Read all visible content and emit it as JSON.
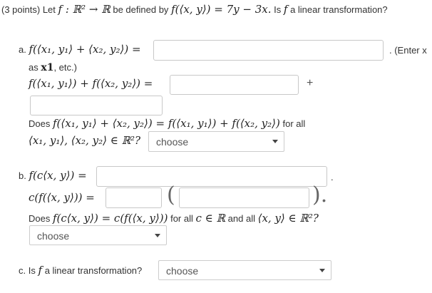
{
  "header": {
    "points": "(3 points)",
    "intro_text": "Let",
    "map": "f : ℝ² → ℝ",
    "defined_text": "be defined by",
    "formula": "f(⟨x, y⟩) = 7y − 3x.",
    "question_pre": "Is",
    "f_symbol": "f",
    "question_post": "a linear transformation?"
  },
  "part_a": {
    "label": "a.",
    "expr1": "f(⟨x₁, y₁⟩ + ⟨x₂, y₂⟩) =",
    "input1_value": "",
    "enter_note": ". (Enter x",
    "hint_pre": "as",
    "hint_code": "x1",
    "hint_post": ", etc.)",
    "expr2": "f(⟨x₁, y₁⟩) + f(⟨x₂, y₂⟩) =",
    "input2_value": "",
    "plus": "+",
    "input3_value": "",
    "question_pre": "Does",
    "question_expr": "f(⟨x₁, y₁⟩ + ⟨x₂, y₂⟩) = f(⟨x₁, y₁⟩) + f(⟨x₂, y₂⟩)",
    "question_post": "for all",
    "question_expr2": "⟨x₁, y₁⟩, ⟨x₂, y₂⟩ ∈ ℝ²?",
    "select_value": "choose"
  },
  "part_b": {
    "label": "b.",
    "expr1": "f(c⟨x, y⟩) =",
    "input1_value": "",
    "dot": ".",
    "expr2": "c(f(⟨x, y⟩)) =",
    "input2_value": "",
    "input3_value": "",
    "paren_open": "(",
    "paren_close": ").",
    "question_pre": "Does",
    "question_expr": "f(c⟨x, y⟩) = c(f(⟨x, y⟩))",
    "question_mid": "for all",
    "question_c": "c ∈ ℝ",
    "question_and": "and all",
    "question_xy": "⟨x, y⟩ ∈ ℝ²?",
    "select_value": "choose"
  },
  "part_c": {
    "label": "c.",
    "question_pre": "Is",
    "f_symbol": "f",
    "question_post": "a linear transformation?",
    "select_value": "choose"
  }
}
